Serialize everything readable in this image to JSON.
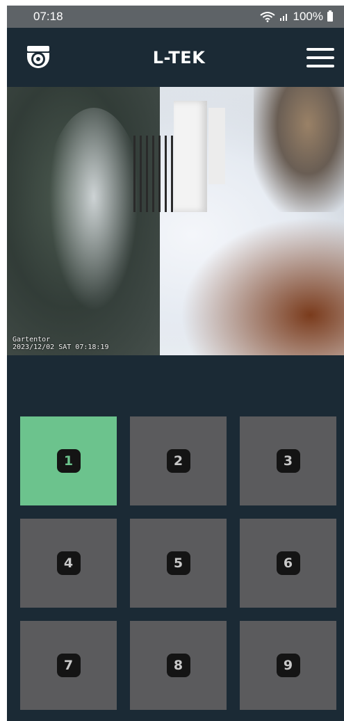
{
  "status_bar": {
    "time": "07:18",
    "battery": "100%"
  },
  "header": {
    "brand": "L-TEK",
    "icons": {
      "left": "camera-dome-icon",
      "right": "hamburger-menu-icon"
    }
  },
  "camera": {
    "name": "Gartentor",
    "timestamp": "2023/12/02 SAT 07:18:19"
  },
  "grid": {
    "selected": "1",
    "cells": [
      "1",
      "2",
      "3",
      "4",
      "5",
      "6",
      "7",
      "8",
      "9"
    ]
  },
  "colors": {
    "background": "#1b2a35",
    "active": "#6cc38d",
    "cell": "#5b5b5d",
    "status_bar": "#5e6367"
  }
}
